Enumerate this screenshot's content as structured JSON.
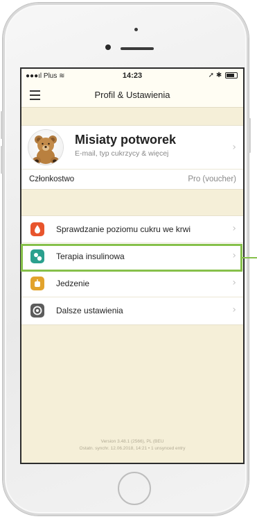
{
  "status_bar": {
    "carrier": "Plus",
    "time": "14:23"
  },
  "navbar": {
    "title": "Profil & Ustawienia"
  },
  "profile": {
    "name": "Misiaty potworek",
    "subtitle": "E-mail, typ cukrzycy & więcej"
  },
  "membership": {
    "label": "Członkostwo",
    "value": "Pro (voucher)"
  },
  "menu": {
    "items": [
      {
        "label": "Sprawdzanie poziomu cukru we krwi",
        "icon": "blood-drop-icon",
        "color": "#e8552d"
      },
      {
        "label": "Terapia insulinowa",
        "icon": "insulin-pen-icon",
        "color": "#2ba08e"
      },
      {
        "label": "Jedzenie",
        "icon": "apple-icon",
        "color": "#e2a32d"
      },
      {
        "label": "Dalsze ustawienia",
        "icon": "settings-icon",
        "color": "#5c5c5c"
      }
    ]
  },
  "footer": {
    "version": "Version 3.48.1 (2566), PL (BEU",
    "sync": "Ostatn. synchr. 12.06.2018, 14:21 • 1 unsynced entry"
  },
  "colors": {
    "highlight": "#86c04a",
    "screen_background": "#f5efd8"
  }
}
